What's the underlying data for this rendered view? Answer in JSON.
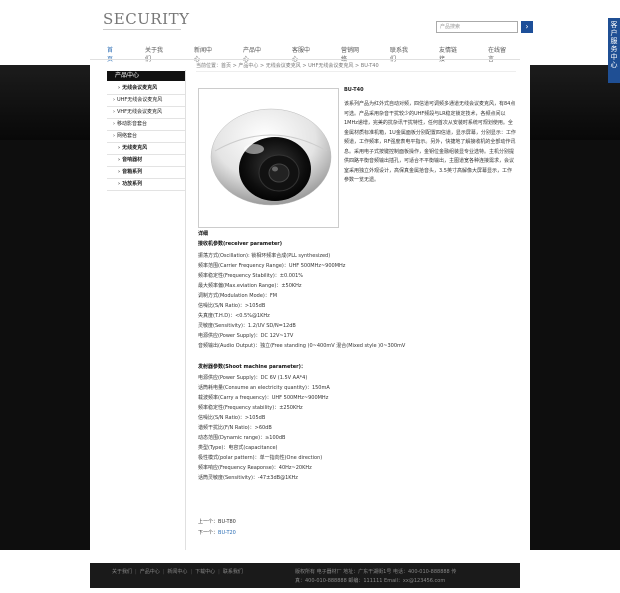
{
  "header": {
    "logo": "SECURITY",
    "search_placeholder": "产品搜索",
    "search_button": "›",
    "side_flag": "客户服务中心"
  },
  "nav": [
    "首页",
    "关于我们",
    "新闻中心",
    "产品中心",
    "客服中心",
    "营销网络",
    "联系我们",
    "友情链接",
    "在线留言"
  ],
  "sidebar": {
    "title": "产品中心",
    "items": [
      {
        "label": "无线会议麦克风",
        "bold": true
      },
      {
        "label": "UHF无线会议麦克风",
        "bold": false
      },
      {
        "label": "VHF无线会议麦克风",
        "bold": false
      },
      {
        "label": "移动影音套台",
        "bold": false
      },
      {
        "label": "网络套台",
        "bold": false
      },
      {
        "label": "无线麦克风",
        "bold": true
      },
      {
        "label": "音响器材",
        "bold": true
      },
      {
        "label": "音箱系列",
        "bold": true
      },
      {
        "label": "功放系列",
        "bold": true
      }
    ]
  },
  "breadcrumb": "当前位置：首页 > 产品中心 > 无线会议麦克风 > UHF无线会议麦克风 > BU-T40",
  "product": {
    "name": "BU-T40",
    "desc": "该系列产品为红外式自动对频，四信道可调频多通道无线会议麦克风，有84点可选。产品采用杂音干扰较少的UHF频段与LR稳定锁定技术，各频点间以1MHz递增，完美的抗杂讯干扰特性，任何首次从安装时系统可规划使用。全金属材质标准机箱，1U金属面板分别配置四信道，显示屏幕，分别显示：工作频道，工作频率，RF强度表电平指示。另外，快捷地了解接收机的全部动作讯息。采用电子式按键控制面板操作，金钥位金融组装显专业选特。主机分别提供四路平衡音频输出插孔，可适合不平衡输出，主图道宽各种连接需求，会议室采用独立外观设计，高保真金属拾音头，3.5英寸高解像大屏幕显示，工作参数一览无遗。"
  },
  "specs": {
    "detail": "详细",
    "receiver_title": "接收机参数(receiver parameter)",
    "receiver": [
      "振荡方式(Oscillation): 锁相环频率合成(PLL synthesized)",
      "频率范围(Carrier Frequency Range)：UHF 500MHz~900MHz",
      "频率稳定性(Frequency Stability)：±0.001%",
      "最大频率偏(Max.eviation Range)：±50KHz",
      "调制方式(Modulation Mode)：FM",
      "信噪比(S/N Ratio)：>105dB",
      "失真度(T.H.D)：<0.5%@1KHz",
      "灵敏度(Sensitivity)：1.2/UV SD/N=12dB",
      "电源供应(Power Supply)：DC 12V~17V",
      "音频输出(Audio Output)：独立(Free standing )0~400mV    混合(Mixed style )0~300mV"
    ],
    "transmitter_title": "发射器参数(Shoot machine parameter)：",
    "transmitter": [
      "电源供应(Power Supply)：DC 6V (1.5V AA*4)",
      "话筒耗电量(Consume an electricity quantity)：150mA",
      "载波频率(Carry a frequency)：UHF 500MHz~900MHz",
      "频率稳定性(Frequency stability)：±250KHz",
      "信噪比(S/N Ratio)：>105dB",
      "谐频干扰比(F/N Ratio)：>60dB",
      "动态范围(Dynamic range)：≥100dB",
      "类型(Type)：电容式(capacitance)",
      "极性模式(polar pattern)：单一指向性(One direction)",
      "频率响应(Frequency Reaponse)：40Hz~20KHz",
      "话筒灵敏度(Sensitivity)：-47±3dB@1KHz"
    ]
  },
  "prevnext": {
    "prev_label": "上一个：",
    "prev_value": "BU-T80",
    "next_label": "下一个：",
    "next_value": "BU-T20"
  },
  "footer": {
    "links": [
      "关于我们",
      "产品中心",
      "新闻中心",
      "下载中心",
      "联系我们"
    ],
    "info_line1": "版权所有   电子器材厂   地址：广东干湖街1号   电话：400-010-888888   传",
    "info_line2": "真：400-010-888888   邮编：111111   Email：xx@123456.com"
  }
}
